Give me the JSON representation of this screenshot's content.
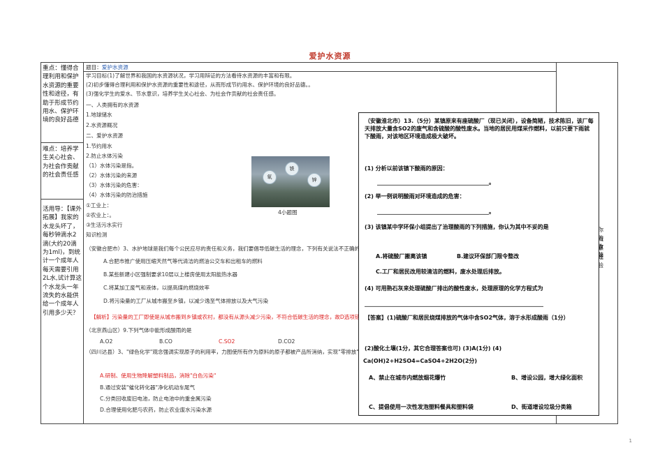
{
  "title": "爱护水资源",
  "left_column": {
    "focus": "重点：懂得合理利用和保护水资源的重要性和途径，有助于形成节约用水、保护环境的良好品德",
    "difficulty": "难点：培养学生关心社会、为社会作贡献的社会责任感",
    "expansion": "活用导：【课外拓展】我家的水龙头坏了，每秒钟滴水2滴(大约20滴为1ml)，到统计一个成年人每天需要引用2L水,试计算这个水龙头一年流失的水能供给一个成年人引用多少天？"
  },
  "header_row": {
    "topic_label": "题目：",
    "topic_value": "爱护水资源"
  },
  "goals": [
    "学习目标(1)了解世界和我国的水资源状况，学习用辩证的方法看待水资源的丰富和有限。",
    "(2)初步懂得合理利用和保护水资源的重要性和途径，从而形成节约用水、保护环境的良好品德。。",
    "(3)强化学生的爱水、节水意识，培养学生关心社会、为社会作贡献的社会责任感。"
  ],
  "main_lines": [
    "一、人类拥有的水资源",
    "1.地球储水",
    "2.水资源概况",
    "二、爱护水资源",
    "1.节约用水",
    "2.防止水体污染",
    "（1）水体污染是指。",
    "（2）水体污染的来源",
    "（3）水体污染的危害：",
    "（4）水体污染的防治措施",
    "①工业上：",
    "②农业上：。",
    "③生活污水实行",
    "知识检测"
  ],
  "picture_caption": "4小题图",
  "picture_bubbles": [
    "氧",
    "铁",
    "锌"
  ],
  "question_hefei": {
    "stem": "（安徽合肥市）3、水护地球是我们每个公民应尽的责任和义务，我们要倡导低碳生活的理念，下列有关说法不正确的是（    ）",
    "options": [
      "A.合肥市推广使用压缩天然气等代清洁的燃油公交车和出租车的燃料",
      "B.某些新建小区强制要求10层以上楼房使用太阳能热水器",
      "C.将某加工废气和液体，以提高煤的燃烧效率",
      "D.将污染量的工厂从城市搬至乡镇，以减少逸至气体排放以及大气污染"
    ],
    "analysis": "【解析】污染量的工厂即使是从城市搬到乡镇或农村，都没有从源头减少污染，不符合低碳生活的理念，故D选项错误。"
  },
  "question_beijing": {
    "stem": "（北京燕山区）9.下列气体中能形成酸雨的是",
    "options": [
      "A.O2",
      "B.CO",
      "C.SO2",
      "D.CO2"
    ]
  },
  "question_sichuan": {
    "stem": "（四川达县）3、\"绿色化学\"观念强调实现原子的利用率，力图使所有作为原料的原子都被产品所消纳，实现\"零排放\"。下列有关说法最符合\"绿色化学\"观念的是",
    "options": [
      "A.研制、使用生物降解塑料制品，消除\"白色污染\"",
      "B.通过安装\"催化转化器\"净化机动车尾气",
      "C.分类回收废旧电池，防止电池中的重金属污染",
      "D.合理使用化肥与农药，防止农业废水污染水源"
    ]
  },
  "right_column": [
    "你的收获",
    "概念",
    "原理",
    "经验"
  ],
  "overlay": {
    "stem": "（安徽淮北市）13.（5分）某镇原来有座硫酸厂（现已关闭），设备简陋，技术陈旧，该厂每天排放大量含SO2的废气和含硫酸的酸性废水。当地的居民用煤采作燃料，以前只要下雨就下酸雨，对该地区环境造成极大破坏。",
    "q1": "(1) 分析以前该镇下酸雨的原因：",
    "q1_blank": "________________________________________。",
    "q2": "(2) 举一例说明酸雨对环境造成的危害：",
    "q2_blank": "________________________________________。",
    "q3": "(3) 该镇某中学环保小组提出了治理酸雨的下列措施，你认为其中不妥的是",
    "q3_options": [
      "A.将硫酸厂搬离该镇",
      "B.建议环保部门限令整改",
      "C.工厂和居民改用较清洁的燃料，废水处理后排放。"
    ],
    "q4": "(4) 可用熟石灰来处理硫酸厂排出的酸性废水，处理原理的化学方程式为",
    "answer1": "【答案】(1)硫酸厂和居民烧煤排放的气体中含SO2气体，溶于水形成酸雨（1分）",
    "answer2": "(2)酸化土壤(1分，其它合理答案也可) (3)A(1分) (4)",
    "answer3": "Ca(OH)2+H2SO4=CaSO4+2H2O(2分)",
    "extra_options": [
      "A、禁止在城市内燃放烟花爆竹",
      "B、增设公园，增大绿化面积",
      "C、提倡使用一次性发泡塑料餐具和塑料袋",
      "D、街道增设垃圾分类箱"
    ]
  },
  "page_number": "1"
}
